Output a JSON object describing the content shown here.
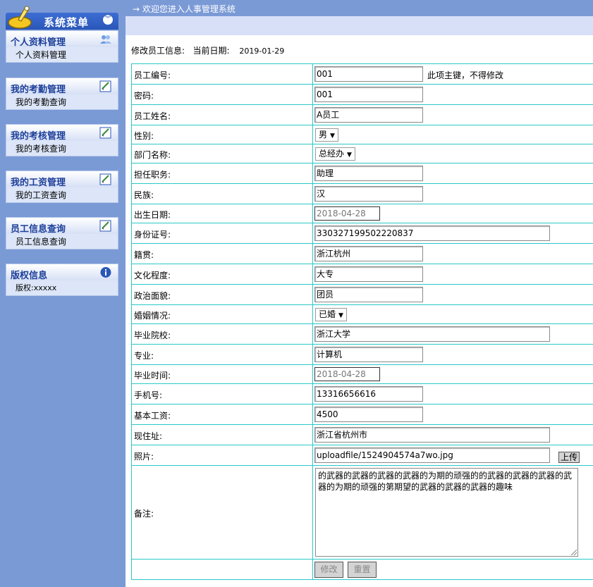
{
  "header": {
    "welcome": "→ 欢迎您进入人事管理系统",
    "menu_title": "系统菜单"
  },
  "sidebar": {
    "groups": [
      {
        "title": "个人资料管理",
        "item": "个人资料管理",
        "icon": "people-icon"
      },
      {
        "title": "我的考勤管理",
        "item": "我的考勤查询",
        "icon": "edit-doc-icon"
      },
      {
        "title": "我的考核管理",
        "item": "我的考核查询",
        "icon": "edit-doc-icon"
      },
      {
        "title": "我的工资管理",
        "item": "我的工资查询",
        "icon": "edit-doc-icon"
      },
      {
        "title": "员工信息查询",
        "item": "员工信息查询",
        "icon": "edit-doc-icon"
      },
      {
        "title": "版权信息",
        "item": "版权:xxxxx",
        "icon": "info-icon"
      }
    ]
  },
  "form": {
    "heading": "修改员工信息:",
    "date_label": "当前日期:",
    "date_value": "2019-01-29",
    "labels": {
      "emp_no": "员工编号:",
      "password": "密码:",
      "name": "员工姓名:",
      "gender": "性别:",
      "dept": "部门名称:",
      "position": "担任职务:",
      "nation": "民族:",
      "birth": "出生日期:",
      "id_card": "身份证号:",
      "native": "籍贯:",
      "education": "文化程度:",
      "politics": "政治面貌:",
      "marriage": "婚姻情况:",
      "school": "毕业院校:",
      "major": "专业:",
      "grad_time": "毕业时间:",
      "phone": "手机号:",
      "salary": "基本工资:",
      "address": "现住址:",
      "photo": "照片:",
      "remark": "备注:"
    },
    "values": {
      "emp_no": "001",
      "emp_no_note": "此项主键，不得修改",
      "password": "001",
      "name": "A员工",
      "gender": "男",
      "dept": "总经办",
      "position": "助理",
      "nation": "汉",
      "birth": "2018-04-28",
      "id_card": "330327199502220837",
      "native": "浙江杭州",
      "education": "大专",
      "politics": "团员",
      "marriage": "已婚",
      "school": "浙江大学",
      "major": "计算机",
      "grad_time": "2018-04-28",
      "phone": "13316656616",
      "salary": "4500",
      "address": "浙江省杭州市",
      "photo": "uploadfile/1524904574a7wo.jpg",
      "remark": "的武器的武器的武器的武器的为期的顽强的的武器的武器的武器的武器的为期的顽强的第期望的武器的武器的武器的趣味"
    },
    "buttons": {
      "upload": "上传",
      "submit": "修改",
      "reset": "重置"
    }
  }
}
